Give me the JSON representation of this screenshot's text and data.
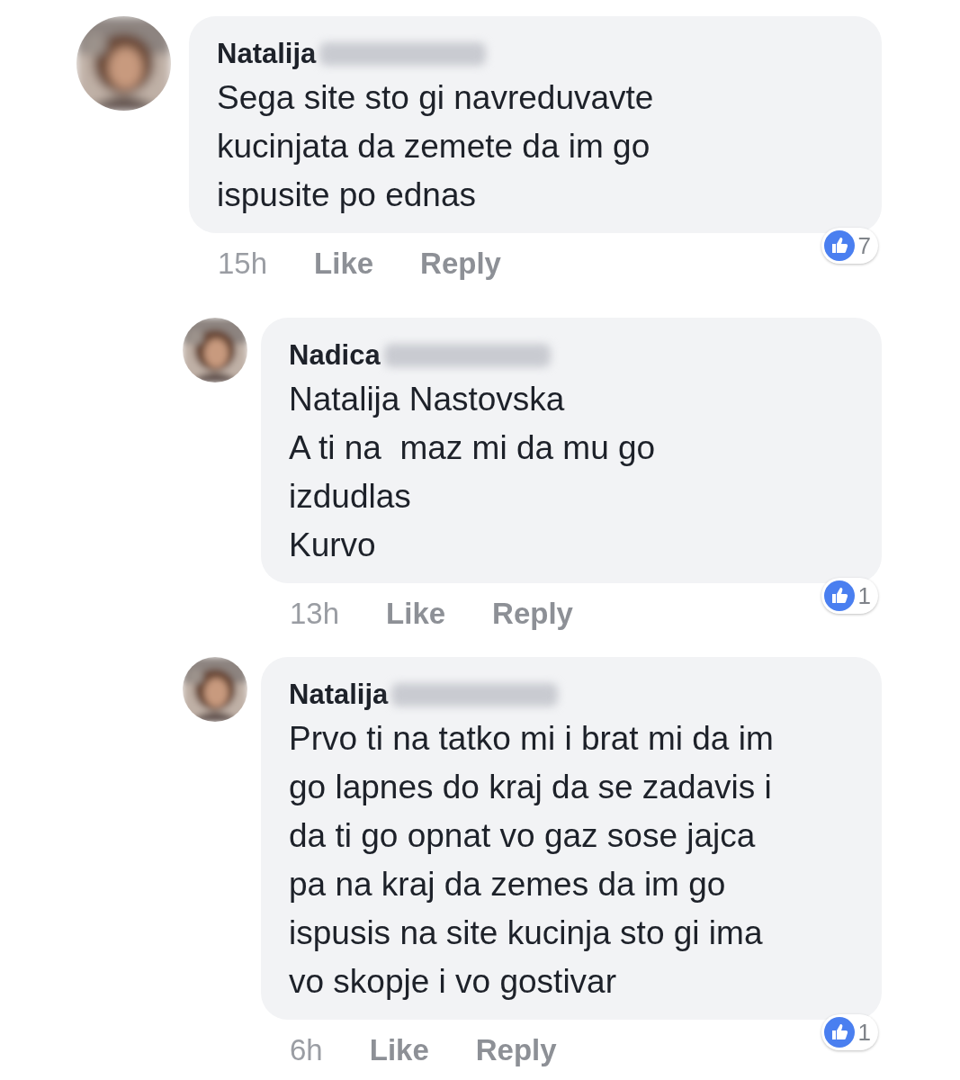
{
  "comments": [
    {
      "kind": "top",
      "author": "Natalija",
      "surname_blurred": true,
      "avatar": {
        "kind": "picture"
      },
      "text": "Sega site sto gi navreduvavte\nkucinjata da zemete da im go\nispusite po ednas",
      "time": "15h",
      "actions": [
        "Like",
        "Reply"
      ],
      "reactions": "7"
    },
    {
      "kind": "reply",
      "author": "Nadica",
      "surname_blurred": true,
      "avatar": {
        "kind": "picture"
      },
      "text": "Natalija Nastovska\nA ti na  maz mi da mu go\nizdudlas\nKurvo",
      "time": "13h",
      "actions": [
        "Like",
        "Reply"
      ],
      "reactions": "1"
    },
    {
      "kind": "reply",
      "author": "Natalija",
      "surname_blurred": true,
      "avatar": {
        "kind": "picture"
      },
      "text": "Prvo ti na tatko mi i brat mi da im\ngo lapnes do kraj da se zadavis i\nda ti go opnat vo gaz sose jajca\npa na kraj da zemes da im go\nispusis na site kucinja sto gi ima\nvo skopje i vo gostivar",
      "time": "6h",
      "actions": [
        "Like",
        "Reply"
      ],
      "reactions": "1"
    }
  ]
}
